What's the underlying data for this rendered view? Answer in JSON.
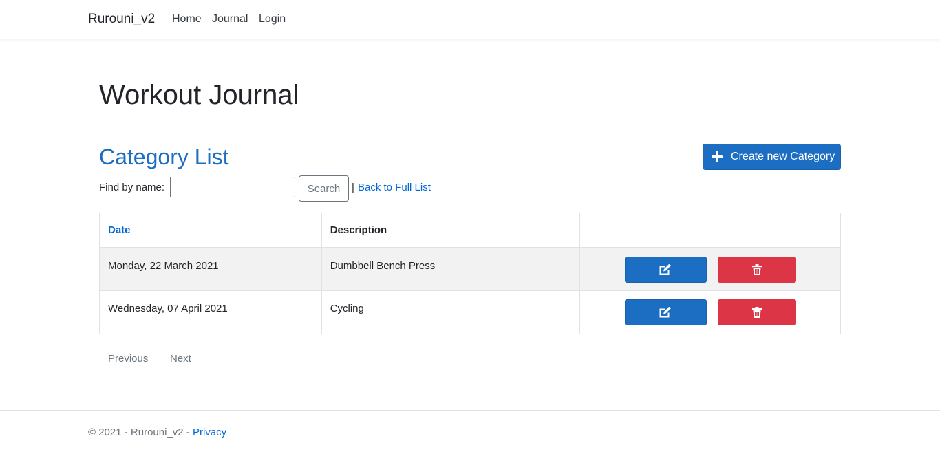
{
  "navbar": {
    "brand": "Rurouni_v2",
    "links": [
      "Home",
      "Journal",
      "Login"
    ]
  },
  "page_title": "Workout Journal",
  "section_title": "Category List",
  "create_button": "Create new Category",
  "search": {
    "label": "Find by name:",
    "value": "",
    "button": "Search",
    "separator": "|",
    "back_link": "Back to Full List"
  },
  "table": {
    "headers": [
      "Date",
      "Description",
      ""
    ],
    "rows": [
      {
        "date": "Monday, 22 March 2021",
        "description": "Dumbbell Bench Press"
      },
      {
        "date": "Wednesday, 07 April 2021",
        "description": "Cycling"
      }
    ]
  },
  "pager": {
    "previous": "Previous",
    "next": "Next"
  },
  "footer": {
    "text": "© 2021 - Rurouni_v2 - ",
    "privacy": "Privacy"
  },
  "colors": {
    "primary": "#1b6ec2",
    "danger": "#dc3545",
    "link": "#0366d6"
  },
  "icons": {
    "create": "plus-icon",
    "edit": "edit-icon",
    "delete": "trash-icon"
  }
}
